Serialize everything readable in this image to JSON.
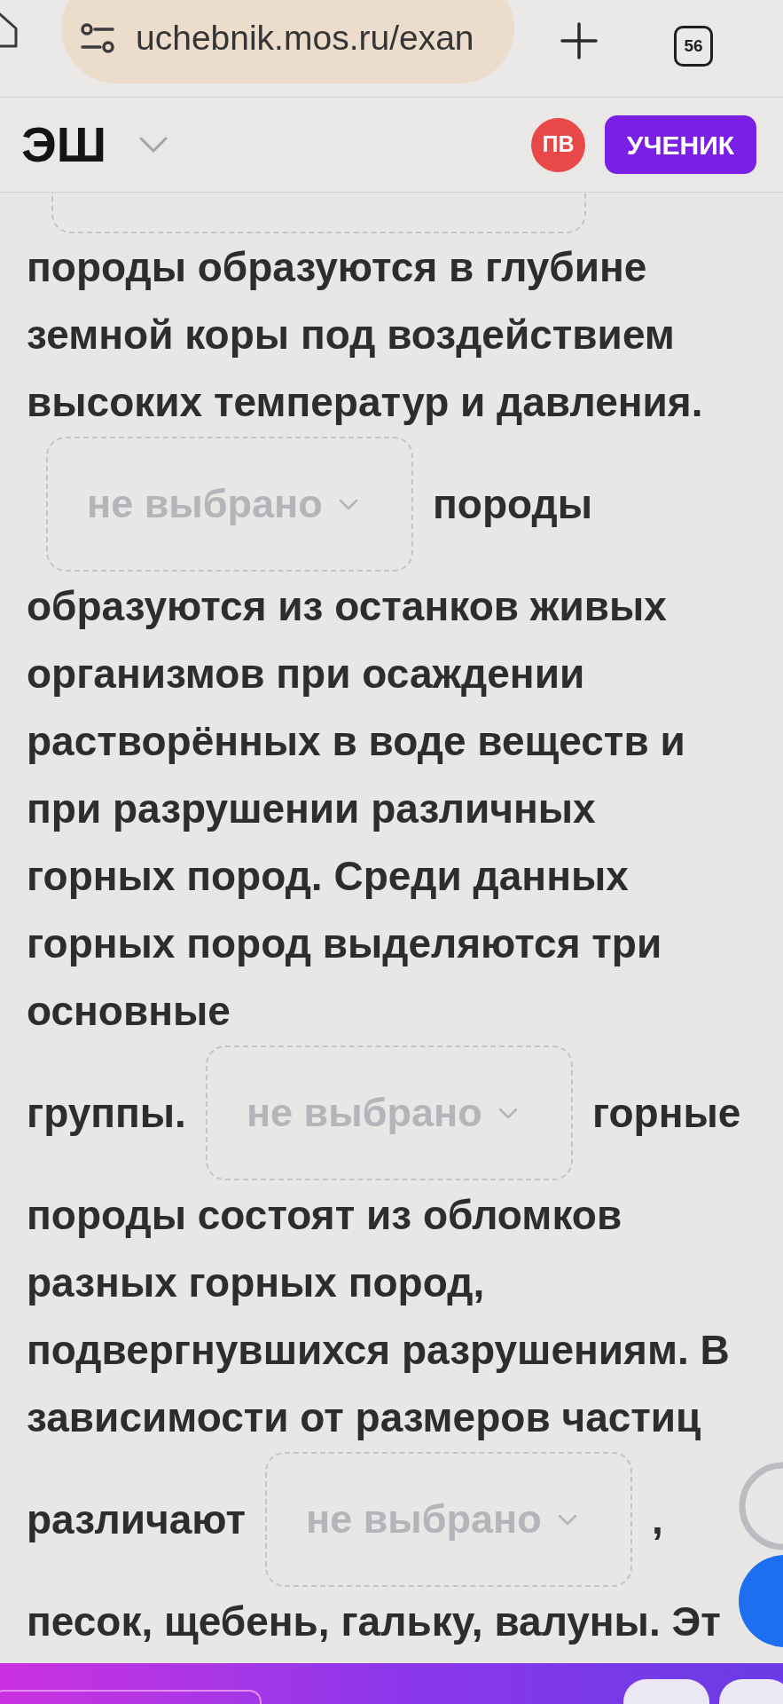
{
  "browser_bar": {
    "url": "uchebnik.mos.ru/exan",
    "tab_count": "56"
  },
  "header": {
    "logo": "ЭШ",
    "avatar_initials": "ПВ",
    "role": "УЧЕНИК"
  },
  "exercise": [
    {
      "kind": "text",
      "text": "породы образуются в глубине земной коры под воздействием высоких температур и давления."
    },
    {
      "kind": "row",
      "items": [
        {
          "kind": "dropdown",
          "placeholder": "не выбрано"
        },
        {
          "kind": "word",
          "text": "породы"
        }
      ]
    },
    {
      "kind": "text",
      "text": "образуются из останков живых организмов при осаждении растворённых в воде веществ и при разрушении различных горных пород. Среди данных горных пород выделяются три основные"
    },
    {
      "kind": "row",
      "items": [
        {
          "kind": "word",
          "text": "группы."
        },
        {
          "kind": "dropdown",
          "placeholder": "не выбрано"
        },
        {
          "kind": "word",
          "text": "горные"
        }
      ]
    },
    {
      "kind": "text",
      "text": "породы состоят из обломков разных горных пород, подвергнувшихся разрушениям. В зависимости от размеров частиц"
    },
    {
      "kind": "row",
      "items": [
        {
          "kind": "word",
          "text": "различают"
        },
        {
          "kind": "dropdown",
          "placeholder": "не выбрано"
        },
        {
          "kind": "word",
          "text": ","
        }
      ]
    },
    {
      "kind": "text",
      "text": "песок, щебень, гальку, валуны. Эт"
    }
  ]
}
